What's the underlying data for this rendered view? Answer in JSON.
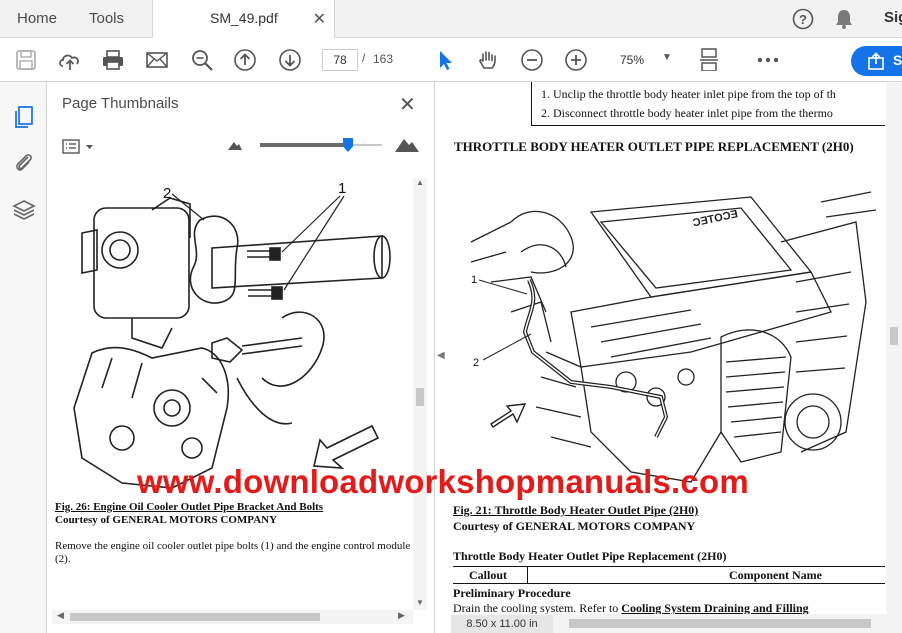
{
  "tabbar": {
    "home": "Home",
    "tools": "Tools",
    "doc_tab_title": "SM_49.pdf",
    "close_glyph": "✕",
    "sign_in": "Sign In"
  },
  "toolbar": {
    "current_page": "78",
    "page_sep": "/",
    "total_pages": "163",
    "zoom": "75%",
    "share_label": "Share"
  },
  "thumbnails": {
    "title": "Page Thumbnails",
    "close_glyph": "✕",
    "slider_value": 0.72,
    "page": {
      "callout_1": "1",
      "callout_2": "2",
      "fig_caption": "Fig. 26: Engine Oil Cooler Outlet Pipe Bracket And Bolts",
      "courtesy": "Courtesy of GENERAL MOTORS COMPANY",
      "body": "Remove the engine oil cooler outlet pipe bolts (1) and the engine control module (2)."
    }
  },
  "document": {
    "list": [
      "1.  Unclip the throttle body heater inlet pipe from the top of th",
      "2.  Disconnect throttle body heater inlet pipe from the thermo"
    ],
    "section_title": "THROTTLE BODY HEATER OUTLET PIPE REPLACEMENT (2H0)",
    "callout_1": "1",
    "callout_2": "2",
    "engine_text": "ECOTEC",
    "fig_caption": "Fig. 21: Throttle Body Heater Outlet Pipe (2H0)",
    "courtesy": "Courtesy of GENERAL MOTORS COMPANY",
    "table_title": "Throttle Body Heater Outlet Pipe Replacement (2H0)",
    "col_callout": "Callout",
    "col_component": "Component Name",
    "preliminary": "Preliminary Procedure",
    "drain_text": "Drain the cooling system. Refer to ",
    "drain_link": "Cooling System Draining and Filling",
    "page_size": "8.50 x 11.00 in"
  },
  "watermark": "www.downloadworkshopmanuals.com",
  "colors": {
    "accent": "#1473e6",
    "watermark": "#e21b1b"
  }
}
